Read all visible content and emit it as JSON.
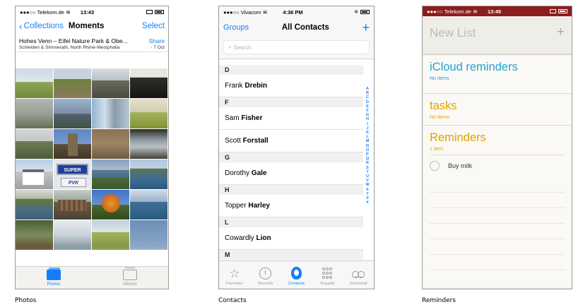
{
  "photos": {
    "status": {
      "carrier": "●●●○○ Telekom.de",
      "wifi": "wifi-icon",
      "time": "13:43"
    },
    "nav": {
      "back_label": "Collections",
      "title": "Moments",
      "select_label": "Select"
    },
    "header": {
      "title": "Hohes Venn – Eifel Nature Park & Obe...",
      "share_label": "Share",
      "subtitle": "Schleiden & Simmerath, North Rhine-Westphalia",
      "date": "7 Oct"
    },
    "grid_sign_main": "SUPER",
    "grid_sign_sub": "PVK",
    "tabs": [
      {
        "label": "Photos",
        "icon": "photos-tab-icon",
        "active": true
      },
      {
        "label": "Albums",
        "icon": "albums-tab-icon",
        "active": false
      }
    ],
    "caption": "Photos"
  },
  "contacts": {
    "status": {
      "carrier": "●●●○○ Vivacom",
      "wifi": "wifi-icon",
      "time": "4:36 PM",
      "bluetooth": "bluetooth-icon"
    },
    "nav": {
      "groups_label": "Groups",
      "title": "All Contacts",
      "add_label": "+"
    },
    "search": {
      "placeholder": "Search"
    },
    "sections": [
      {
        "letter": "D",
        "contacts": [
          {
            "first": "Frank",
            "last": "Drebin"
          }
        ]
      },
      {
        "letter": "F",
        "contacts": [
          {
            "first": "Sam",
            "last": "Fisher"
          },
          {
            "first": "Scott",
            "last": "Forstall"
          }
        ]
      },
      {
        "letter": "G",
        "contacts": [
          {
            "first": "Dorothy",
            "last": "Gale"
          }
        ]
      },
      {
        "letter": "H",
        "contacts": [
          {
            "first": "Topper",
            "last": "Harley"
          }
        ]
      },
      {
        "letter": "L",
        "contacts": [
          {
            "first": "Cowardly",
            "last": "Lion"
          }
        ]
      },
      {
        "letter": "M",
        "contacts": []
      }
    ],
    "index_letters": [
      "A",
      "B",
      "C",
      "D",
      "E",
      "F",
      "G",
      "H",
      "I",
      "J",
      "K",
      "L",
      "M",
      "N",
      "O",
      "P",
      "Q",
      "R",
      "S",
      "T",
      "U",
      "V",
      "W",
      "X",
      "Y",
      "Z",
      "#"
    ],
    "tabs": [
      {
        "label": "Favorites",
        "icon": "star-icon",
        "active": false
      },
      {
        "label": "Recents",
        "icon": "clock-icon",
        "active": false
      },
      {
        "label": "Contacts",
        "icon": "contact-icon",
        "active": true
      },
      {
        "label": "Keypad",
        "icon": "keypad-icon",
        "active": false
      },
      {
        "label": "Voicemail",
        "icon": "voicemail-icon",
        "active": false
      }
    ],
    "caption": "Contacts"
  },
  "reminders": {
    "status": {
      "carrier": "●●●○○ Telekom.de",
      "wifi": "wifi-icon",
      "time": "13:45"
    },
    "new_list": {
      "title": "New List",
      "add_label": "+"
    },
    "lists": [
      {
        "title": "iCloud reminders",
        "subtitle": "No items",
        "color": "#21a2d8"
      },
      {
        "title": "tasks",
        "subtitle": "No items",
        "color": "#e1a400"
      },
      {
        "title": "Reminders",
        "subtitle": "1 item",
        "color": "#e1a400",
        "items": [
          {
            "text": "Buy milk",
            "done": false
          }
        ]
      }
    ],
    "caption": "Reminders"
  },
  "colors": {
    "ios_blue": "#147efb",
    "reminders_status": "#8c1d1d",
    "icloud_blue": "#21a2d8",
    "gold": "#e1a400"
  }
}
